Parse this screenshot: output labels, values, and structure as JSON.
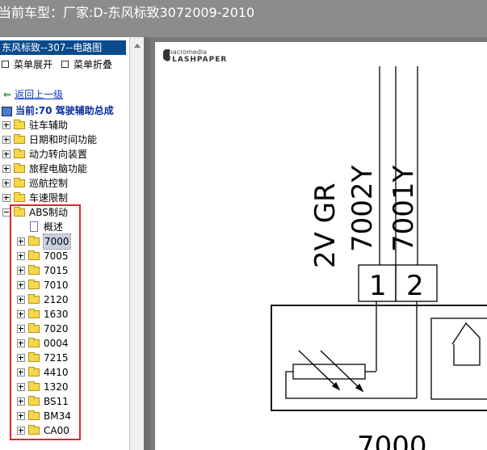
{
  "title": "当前车型：厂家:D-东风标致3072009-2010",
  "sidebar": {
    "header": "东风标致--307--电路图",
    "expand_label": "菜单展开",
    "collapse_label": "菜单折叠",
    "back_label": "返回上一级",
    "current_label": "当前:70 驾驶辅助总成",
    "top_items": [
      "驻车辅助",
      "日期和时间功能",
      "动力转向装置",
      "旅程电脑功能",
      "巡航控制",
      "车速限制"
    ],
    "abs_label": "ABS制动",
    "overview_label": "概述",
    "abs_children": [
      "7000",
      "7005",
      "7015",
      "7010",
      "2120",
      "1630",
      "7020",
      "0004",
      "7215",
      "4410",
      "1320",
      "BS11",
      "BM34",
      "CA00"
    ],
    "selected": "7000"
  },
  "viewer": {
    "logo_top": "macromedia",
    "logo_bottom": "FLASHPAPER",
    "diagram": {
      "wire_label_1": "2V GR",
      "wire_code_1": "7002Y",
      "wire_code_2": "7001Y",
      "pin_1": "1",
      "pin_2": "2",
      "component": "7000"
    }
  },
  "colors": {
    "highlight_box": "#e0242c",
    "selected_header": "#0a4b8c",
    "link": "#0a3cc8"
  }
}
